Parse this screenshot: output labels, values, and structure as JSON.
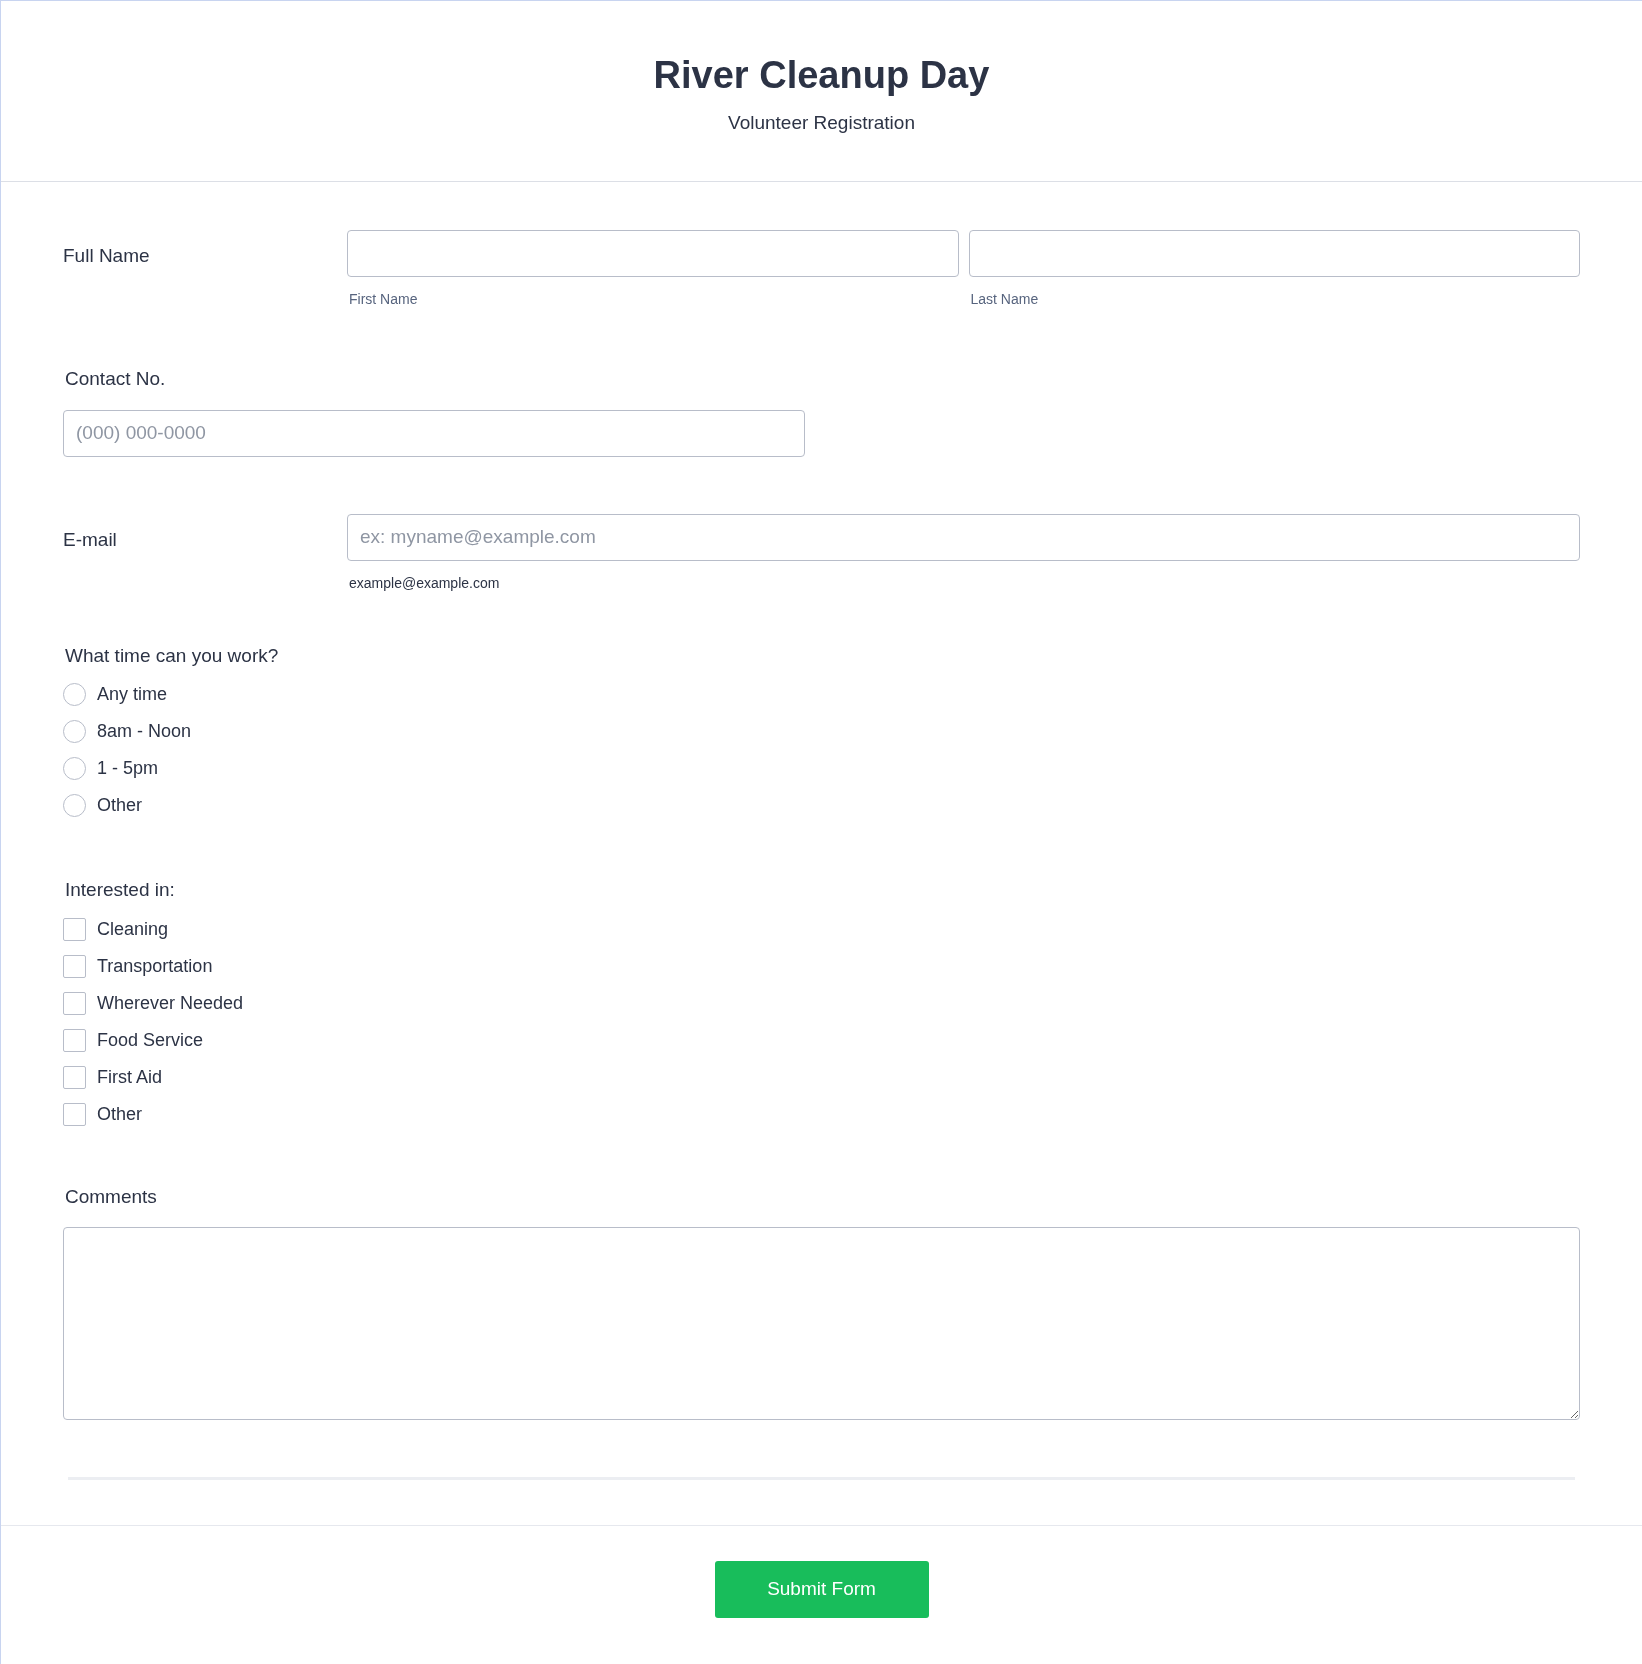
{
  "header": {
    "title": "River Cleanup Day",
    "subtitle": "Volunteer Registration"
  },
  "full_name": {
    "label": "Full Name",
    "fields": [
      {
        "sublabel": "First Name"
      },
      {
        "sublabel": "Last Name"
      }
    ]
  },
  "contact": {
    "label": "Contact No.",
    "placeholder": "(000) 000-0000"
  },
  "email": {
    "label": "E-mail",
    "placeholder": "ex: myname@example.com",
    "sublabel": "example@example.com"
  },
  "time": {
    "label": "What time can you work?",
    "options": [
      {
        "label": "Any time",
        "selected": false
      },
      {
        "label": "8am - Noon",
        "selected": false
      },
      {
        "label": "1 - 5pm",
        "selected": false
      },
      {
        "label": "Other",
        "selected": false
      }
    ]
  },
  "interests": {
    "label": "Interested in:",
    "options": [
      {
        "label": "Cleaning",
        "checked": false
      },
      {
        "label": "Transportation",
        "checked": false
      },
      {
        "label": "Wherever Needed",
        "checked": false
      },
      {
        "label": "Food Service",
        "checked": false
      },
      {
        "label": "First Aid",
        "checked": false
      },
      {
        "label": "Other",
        "checked": false
      }
    ]
  },
  "comments": {
    "label": "Comments"
  },
  "submit": {
    "label": "Submit Form"
  }
}
